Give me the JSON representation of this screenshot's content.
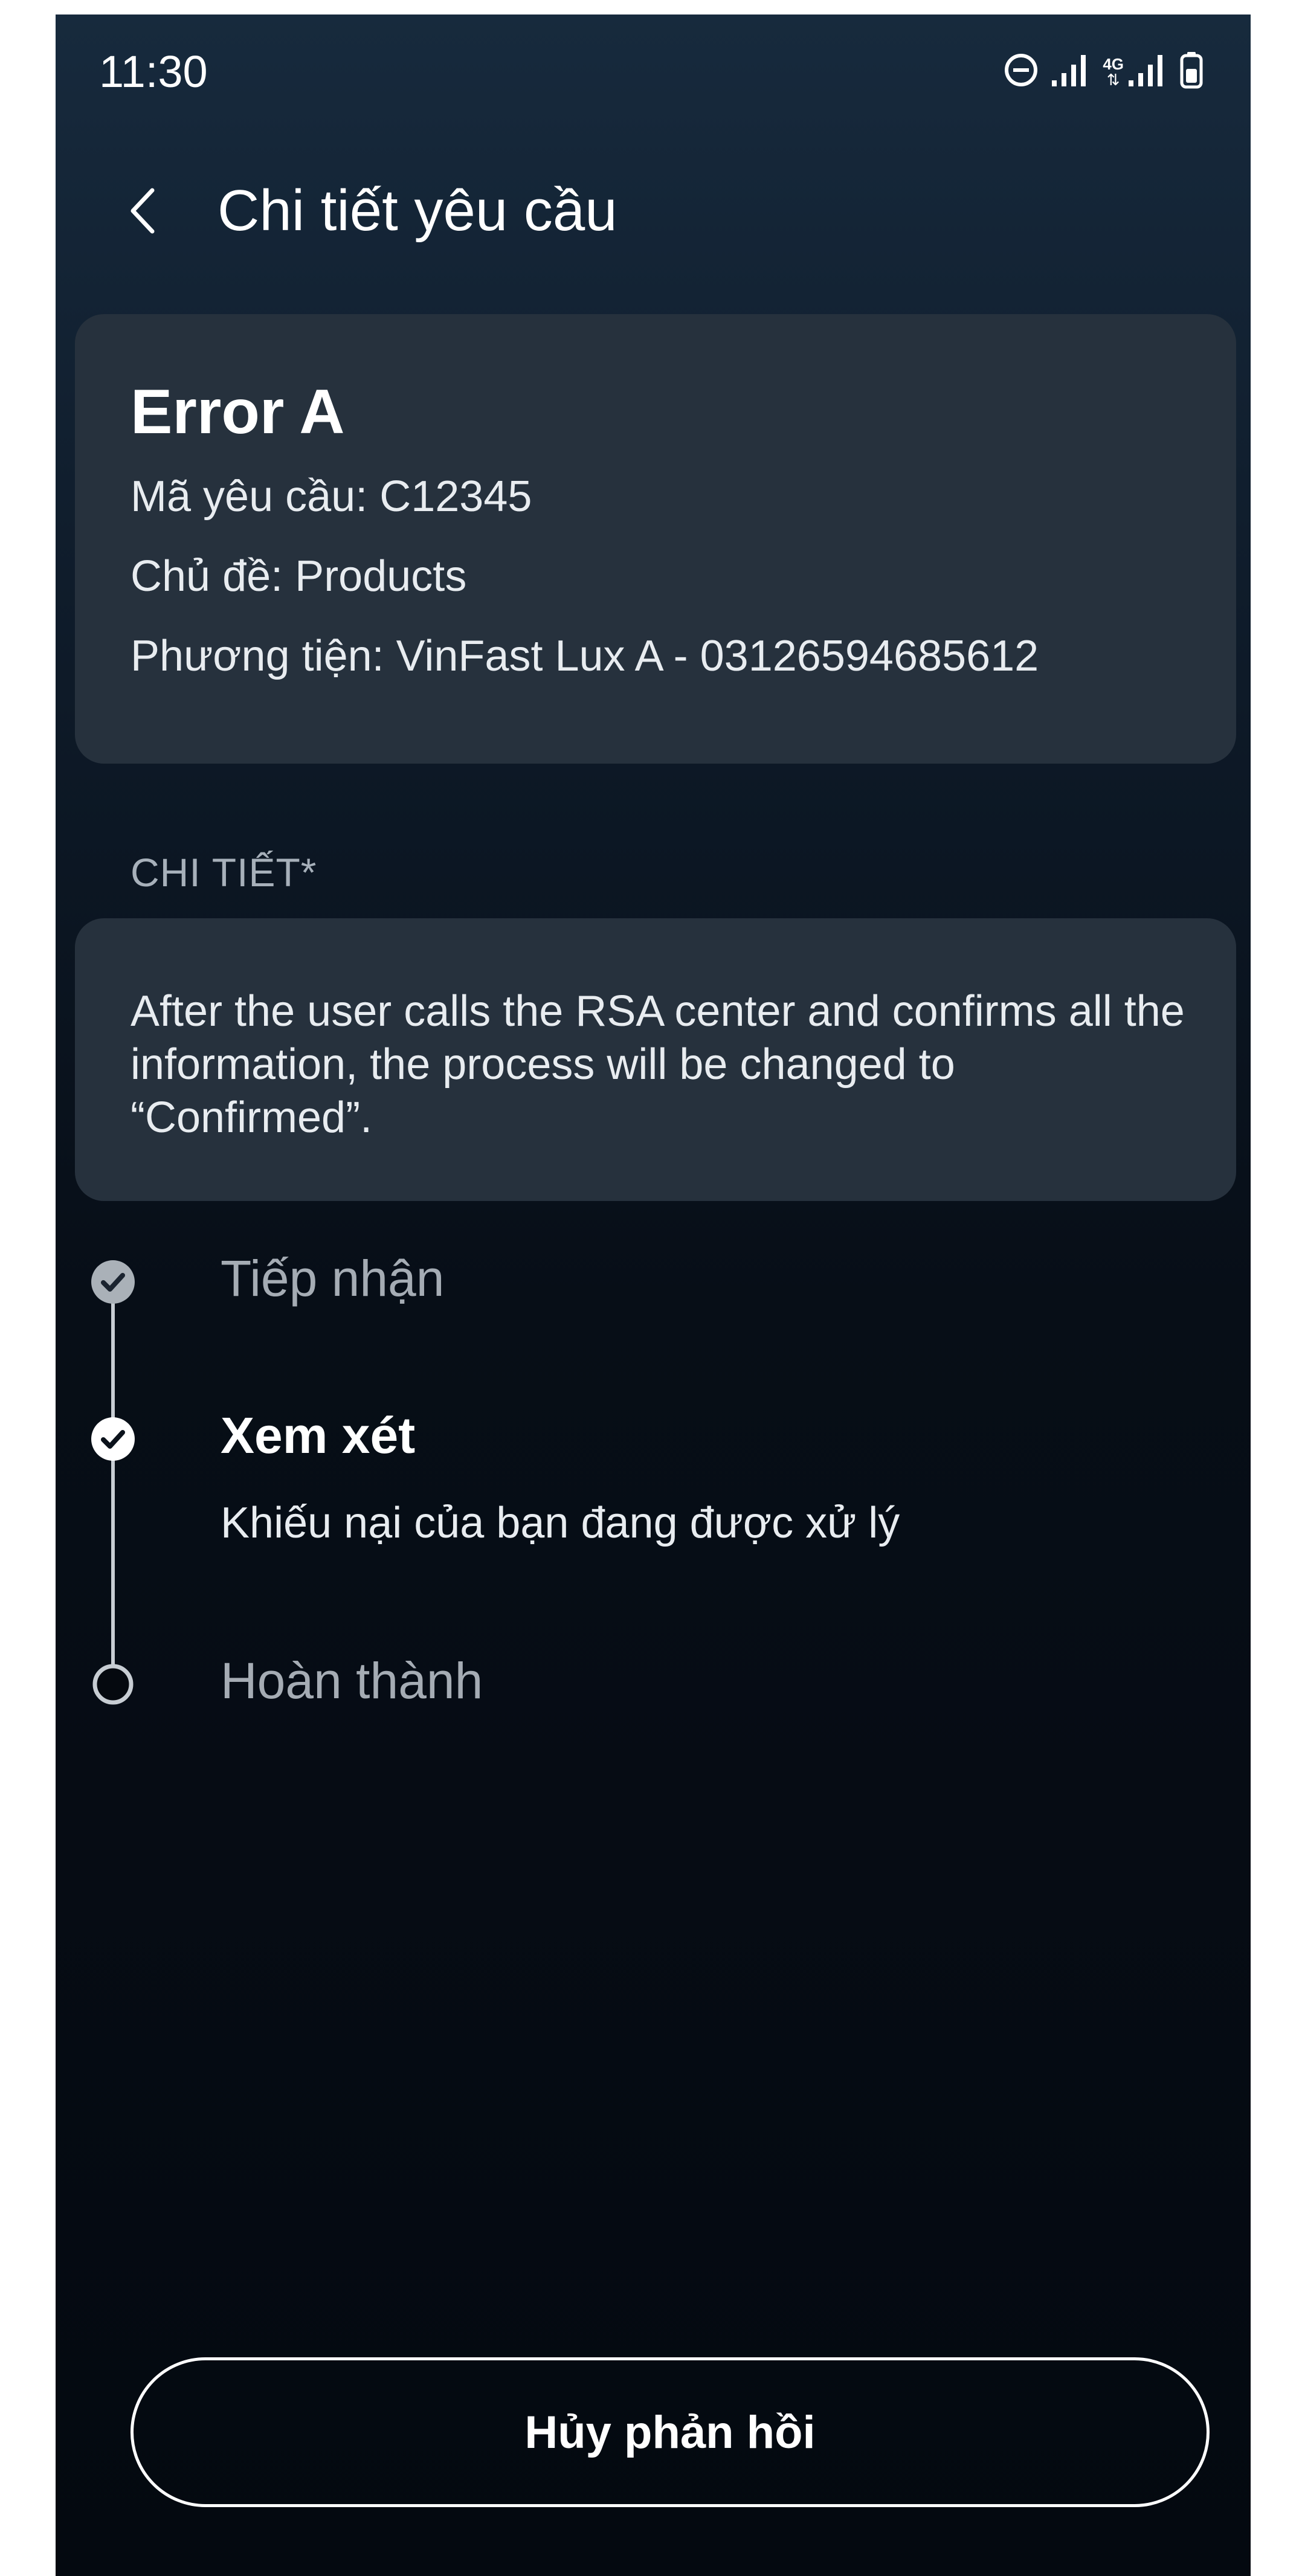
{
  "status_bar": {
    "time": "11:30",
    "network_label": "4G",
    "icons": [
      "do-not-disturb-icon",
      "signal-icon",
      "4g-signal-icon",
      "battery-icon"
    ]
  },
  "header": {
    "back_icon": "chevron-left-icon",
    "title": "Chi tiết yêu cầu"
  },
  "request": {
    "title": "Error A",
    "code_line": "Mã yêu cầu: C12345",
    "topic_line": "Chủ đề: Products",
    "vehicle_line": "Phương tiện: VinFast Lux A - 03126594685612"
  },
  "details": {
    "section_label": "CHI TIẾT*",
    "text": "After the user calls the RSA center and confirms all the information, the process will be changed to “Confirmed”."
  },
  "timeline": {
    "steps": [
      {
        "label": "Tiếp nhận",
        "state": "completed",
        "icon": "check-circle-icon"
      },
      {
        "label": "Xem xét",
        "state": "current",
        "icon": "check-circle-icon",
        "description": "Khiếu nại của bạn đang được xử lý"
      },
      {
        "label": "Hoàn thành",
        "state": "pending",
        "icon": "empty-circle-icon"
      }
    ]
  },
  "actions": {
    "cancel_label": "Hủy phản hồi"
  },
  "colors": {
    "background_top": "#172a3d",
    "background_bottom": "#040910",
    "card": "#26313d",
    "muted_text": "#a5acb4",
    "text": "#ffffff"
  }
}
